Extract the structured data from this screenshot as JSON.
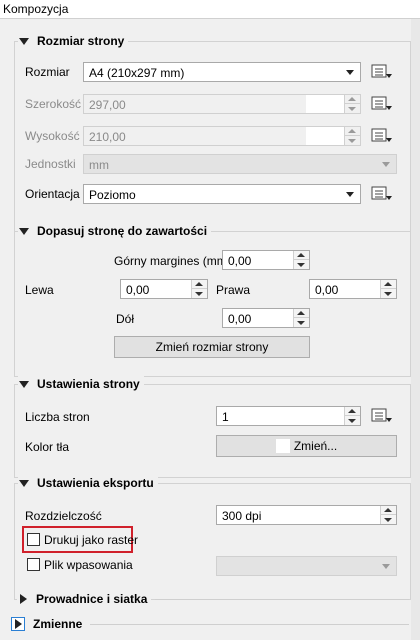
{
  "window": {
    "title": "Kompozycja"
  },
  "page_size": {
    "header": "Rozmiar strony",
    "size_label": "Rozmiar",
    "size_value": "A4 (210x297 mm)",
    "width_label": "Szerokość",
    "width_value": "297,00",
    "height_label": "Wysokość",
    "height_value": "210,00",
    "units_label": "Jednostki",
    "units_value": "mm",
    "orientation_label": "Orientacja",
    "orientation_value": "Poziomo"
  },
  "fit_to_content": {
    "header": "Dopasuj stronę do zawartości",
    "top_label": "Górny margines (mm)",
    "top_value": "0,00",
    "left_label": "Lewa",
    "left_value": "0,00",
    "right_label": "Prawa",
    "right_value": "0,00",
    "bottom_label": "Dół",
    "bottom_value": "0,00",
    "resize_button": "Zmień rozmiar strony"
  },
  "page_settings": {
    "header": "Ustawienia strony",
    "pages_label": "Liczba stron",
    "pages_value": "1",
    "bg_label": "Kolor tła",
    "bg_button": "Zmień...",
    "bg_color": "#ffffff"
  },
  "export_settings": {
    "header": "Ustawienia eksportu",
    "resolution_label": "Rozdzielczość",
    "resolution_value": "300 dpi",
    "raster_label": "Drukuj jako raster",
    "raster_checked": false,
    "world_file_label": "Plik wpasowania",
    "world_file_checked": false
  },
  "collapsed": {
    "guides_header": "Prowadnice i siatka",
    "variables_header": "Zmienne"
  },
  "colors": {
    "highlight_border": "#d0202b",
    "panel_bg": "#f0f0f0"
  }
}
